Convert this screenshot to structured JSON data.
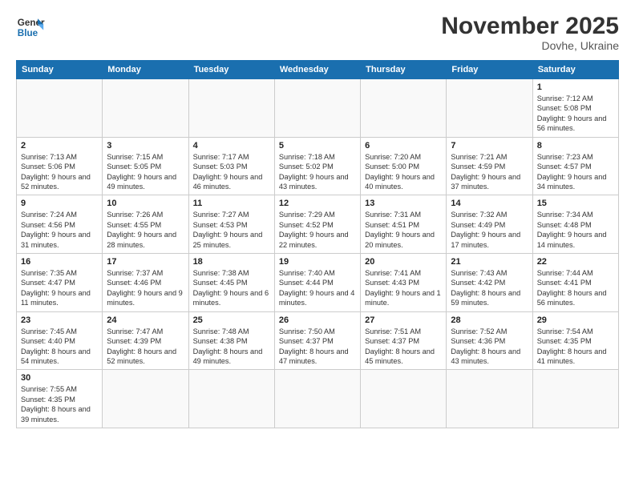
{
  "logo": {
    "line1": "General",
    "line2": "Blue"
  },
  "title": "November 2025",
  "subtitle": "Dovhe, Ukraine",
  "days_header": [
    "Sunday",
    "Monday",
    "Tuesday",
    "Wednesday",
    "Thursday",
    "Friday",
    "Saturday"
  ],
  "weeks": [
    [
      {
        "day": "",
        "info": ""
      },
      {
        "day": "",
        "info": ""
      },
      {
        "day": "",
        "info": ""
      },
      {
        "day": "",
        "info": ""
      },
      {
        "day": "",
        "info": ""
      },
      {
        "day": "",
        "info": ""
      },
      {
        "day": "1",
        "info": "Sunrise: 7:12 AM\nSunset: 5:08 PM\nDaylight: 9 hours and 56 minutes."
      }
    ],
    [
      {
        "day": "2",
        "info": "Sunrise: 7:13 AM\nSunset: 5:06 PM\nDaylight: 9 hours and 52 minutes."
      },
      {
        "day": "3",
        "info": "Sunrise: 7:15 AM\nSunset: 5:05 PM\nDaylight: 9 hours and 49 minutes."
      },
      {
        "day": "4",
        "info": "Sunrise: 7:17 AM\nSunset: 5:03 PM\nDaylight: 9 hours and 46 minutes."
      },
      {
        "day": "5",
        "info": "Sunrise: 7:18 AM\nSunset: 5:02 PM\nDaylight: 9 hours and 43 minutes."
      },
      {
        "day": "6",
        "info": "Sunrise: 7:20 AM\nSunset: 5:00 PM\nDaylight: 9 hours and 40 minutes."
      },
      {
        "day": "7",
        "info": "Sunrise: 7:21 AM\nSunset: 4:59 PM\nDaylight: 9 hours and 37 minutes."
      },
      {
        "day": "8",
        "info": "Sunrise: 7:23 AM\nSunset: 4:57 PM\nDaylight: 9 hours and 34 minutes."
      }
    ],
    [
      {
        "day": "9",
        "info": "Sunrise: 7:24 AM\nSunset: 4:56 PM\nDaylight: 9 hours and 31 minutes."
      },
      {
        "day": "10",
        "info": "Sunrise: 7:26 AM\nSunset: 4:55 PM\nDaylight: 9 hours and 28 minutes."
      },
      {
        "day": "11",
        "info": "Sunrise: 7:27 AM\nSunset: 4:53 PM\nDaylight: 9 hours and 25 minutes."
      },
      {
        "day": "12",
        "info": "Sunrise: 7:29 AM\nSunset: 4:52 PM\nDaylight: 9 hours and 22 minutes."
      },
      {
        "day": "13",
        "info": "Sunrise: 7:31 AM\nSunset: 4:51 PM\nDaylight: 9 hours and 20 minutes."
      },
      {
        "day": "14",
        "info": "Sunrise: 7:32 AM\nSunset: 4:49 PM\nDaylight: 9 hours and 17 minutes."
      },
      {
        "day": "15",
        "info": "Sunrise: 7:34 AM\nSunset: 4:48 PM\nDaylight: 9 hours and 14 minutes."
      }
    ],
    [
      {
        "day": "16",
        "info": "Sunrise: 7:35 AM\nSunset: 4:47 PM\nDaylight: 9 hours and 11 minutes."
      },
      {
        "day": "17",
        "info": "Sunrise: 7:37 AM\nSunset: 4:46 PM\nDaylight: 9 hours and 9 minutes."
      },
      {
        "day": "18",
        "info": "Sunrise: 7:38 AM\nSunset: 4:45 PM\nDaylight: 9 hours and 6 minutes."
      },
      {
        "day": "19",
        "info": "Sunrise: 7:40 AM\nSunset: 4:44 PM\nDaylight: 9 hours and 4 minutes."
      },
      {
        "day": "20",
        "info": "Sunrise: 7:41 AM\nSunset: 4:43 PM\nDaylight: 9 hours and 1 minute."
      },
      {
        "day": "21",
        "info": "Sunrise: 7:43 AM\nSunset: 4:42 PM\nDaylight: 8 hours and 59 minutes."
      },
      {
        "day": "22",
        "info": "Sunrise: 7:44 AM\nSunset: 4:41 PM\nDaylight: 8 hours and 56 minutes."
      }
    ],
    [
      {
        "day": "23",
        "info": "Sunrise: 7:45 AM\nSunset: 4:40 PM\nDaylight: 8 hours and 54 minutes."
      },
      {
        "day": "24",
        "info": "Sunrise: 7:47 AM\nSunset: 4:39 PM\nDaylight: 8 hours and 52 minutes."
      },
      {
        "day": "25",
        "info": "Sunrise: 7:48 AM\nSunset: 4:38 PM\nDaylight: 8 hours and 49 minutes."
      },
      {
        "day": "26",
        "info": "Sunrise: 7:50 AM\nSunset: 4:37 PM\nDaylight: 8 hours and 47 minutes."
      },
      {
        "day": "27",
        "info": "Sunrise: 7:51 AM\nSunset: 4:37 PM\nDaylight: 8 hours and 45 minutes."
      },
      {
        "day": "28",
        "info": "Sunrise: 7:52 AM\nSunset: 4:36 PM\nDaylight: 8 hours and 43 minutes."
      },
      {
        "day": "29",
        "info": "Sunrise: 7:54 AM\nSunset: 4:35 PM\nDaylight: 8 hours and 41 minutes."
      }
    ],
    [
      {
        "day": "30",
        "info": "Sunrise: 7:55 AM\nSunset: 4:35 PM\nDaylight: 8 hours and 39 minutes."
      },
      {
        "day": "",
        "info": ""
      },
      {
        "day": "",
        "info": ""
      },
      {
        "day": "",
        "info": ""
      },
      {
        "day": "",
        "info": ""
      },
      {
        "day": "",
        "info": ""
      },
      {
        "day": "",
        "info": ""
      }
    ]
  ]
}
